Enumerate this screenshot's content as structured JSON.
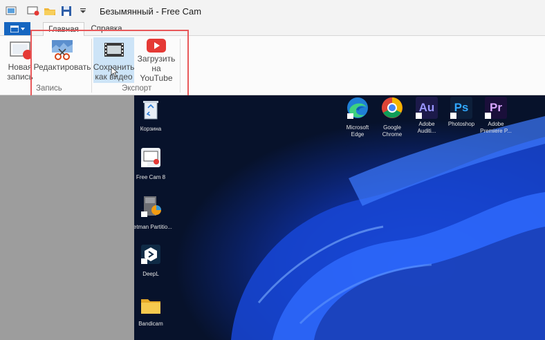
{
  "window": {
    "title": "Безымянный - Free Cam"
  },
  "quick_access": [
    "new-record-icon",
    "open-folder-icon",
    "save-icon",
    "customize-dropdown-icon"
  ],
  "ribbon_tabs": [
    {
      "label": "Главная"
    },
    {
      "label": "Справка"
    }
  ],
  "ribbon": {
    "new_record": {
      "line1": "Новая",
      "line2": "запись"
    },
    "edit": {
      "label": "Редактировать"
    },
    "save_video": {
      "line1": "Сохранить",
      "line2": "как видео"
    },
    "upload": {
      "line1": "Загрузить",
      "line2": "на YouTube"
    },
    "groups": [
      {
        "label": "Запись"
      },
      {
        "label": "Экспорт"
      }
    ]
  },
  "colors": {
    "accent": "#1565c0",
    "highlight": "#cde4f7",
    "callout": "#e8585a"
  },
  "desktop": {
    "icons_left": [
      {
        "label": "Корзина"
      },
      {
        "label": "Free Cam 8"
      },
      {
        "label": "Hetman Partitio..."
      },
      {
        "label": "DeepL"
      },
      {
        "label": "Bandicam"
      }
    ],
    "icons_top": [
      {
        "line1": "Microsoft",
        "line2": "Edge"
      },
      {
        "line1": "Google",
        "line2": "Chrome"
      },
      {
        "line1": "Adobe",
        "line2": "Auditi...",
        "badge": "Au"
      },
      {
        "line1": "Photoshop",
        "line2": "",
        "badge": "Ps"
      },
      {
        "line1": "Adobe",
        "line2": "Premiere P...",
        "badge": "Pr"
      }
    ]
  }
}
